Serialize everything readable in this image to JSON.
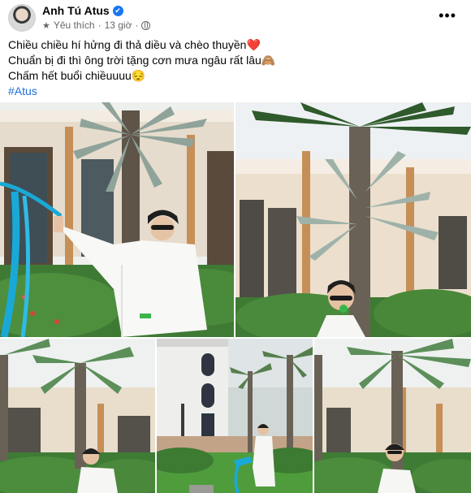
{
  "post": {
    "author": "Anh Tú Atus",
    "verified_mark": "✔",
    "meta_label": "Yêu thích",
    "separator": "·",
    "time": "13 giờ",
    "more_label": "•••",
    "caption_lines": [
      "Chiều chiều hí hửng đi thả diều và chèo thuyền❤️",
      "Chuẩn bị đi thì ông trời tặng cơn mưa ngâu rất lâu🙈",
      "Chấm hết buổi chiềuuuu😔"
    ],
    "hashtag": "#Atus"
  },
  "icons": {
    "verified": "verified-badge-icon",
    "favorite": "star-icon",
    "audience": "globe-icon",
    "more": "more-options-icon"
  },
  "colors": {
    "brand_blue": "#1877f2",
    "hashtag": "#216fdb",
    "secondary_text": "#65676b"
  }
}
